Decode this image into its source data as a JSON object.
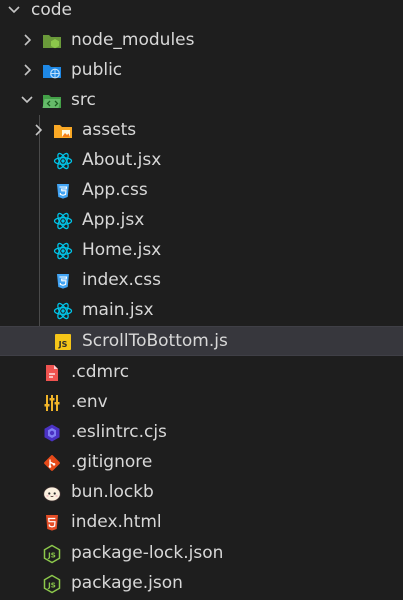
{
  "explorer": {
    "root": {
      "label": "code",
      "expanded": true
    },
    "items": [
      {
        "label": "node_modules",
        "kind": "folder",
        "icon": "node-folder-icon",
        "expanded": false
      },
      {
        "label": "public",
        "kind": "folder",
        "icon": "public-folder-icon",
        "expanded": false
      },
      {
        "label": "src",
        "kind": "folder",
        "icon": "src-folder-icon",
        "expanded": true
      },
      {
        "label": "assets",
        "kind": "folder",
        "icon": "assets-folder-icon",
        "expanded": false
      },
      {
        "label": "About.jsx",
        "kind": "file",
        "icon": "react-icon"
      },
      {
        "label": "App.css",
        "kind": "file",
        "icon": "css-icon"
      },
      {
        "label": "App.jsx",
        "kind": "file",
        "icon": "react-icon"
      },
      {
        "label": "Home.jsx",
        "kind": "file",
        "icon": "react-icon"
      },
      {
        "label": "index.css",
        "kind": "file",
        "icon": "css-icon"
      },
      {
        "label": "main.jsx",
        "kind": "file",
        "icon": "react-icon"
      },
      {
        "label": "ScrollToBottom.js",
        "kind": "file",
        "icon": "js-icon",
        "selected": true
      },
      {
        "label": ".cdmrc",
        "kind": "file",
        "icon": "cdmrc-icon"
      },
      {
        "label": ".env",
        "kind": "file",
        "icon": "env-icon"
      },
      {
        "label": ".eslintrc.cjs",
        "kind": "file",
        "icon": "eslint-icon"
      },
      {
        "label": ".gitignore",
        "kind": "file",
        "icon": "git-icon"
      },
      {
        "label": "bun.lockb",
        "kind": "file",
        "icon": "bun-icon"
      },
      {
        "label": "index.html",
        "kind": "file",
        "icon": "html-icon"
      },
      {
        "label": "package-lock.json",
        "kind": "file",
        "icon": "nodejs-icon"
      },
      {
        "label": "package.json",
        "kind": "file",
        "icon": "nodejs-icon"
      }
    ]
  },
  "colors": {
    "background": "#1e1e1e",
    "selected_row": "#37373d",
    "react": "#00c4e8",
    "css": "#42a5f5",
    "js": "#f5c518",
    "html": "#e44d26",
    "git": "#e64a19",
    "node": "#8cc84b",
    "eslint": "#4b32c3",
    "env": "#f0b429",
    "cdmrc": "#ef5350",
    "folder_blue": "#1e88e5",
    "folder_yellow": "#f9a825",
    "folder_green": "#43a047"
  }
}
